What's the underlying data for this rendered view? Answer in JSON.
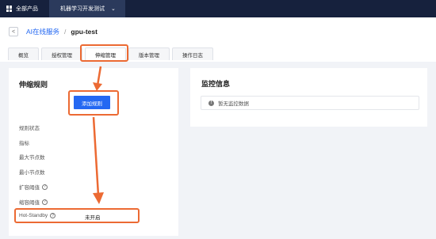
{
  "topbar": {
    "products_label": "全部产品",
    "project_label": "机器学习开发测试",
    "project_chevron": "chevron-down"
  },
  "breadcrumb": {
    "parent": "AI在线服务",
    "separator": "/",
    "current": "gpu-test"
  },
  "tabs": [
    "概览",
    "授权管理",
    "伸缩管理",
    "版本管理",
    "操作日志"
  ],
  "active_tab": "伸缩管理",
  "scaling": {
    "title": "伸缩规则",
    "add_button": "添加规则",
    "rows": [
      {
        "label": "规则状态",
        "help": false,
        "value": ""
      },
      {
        "label": "指标",
        "help": false,
        "value": ""
      },
      {
        "label": "最大节点数",
        "help": false,
        "value": ""
      },
      {
        "label": "最小节点数",
        "help": false,
        "value": ""
      },
      {
        "label": "扩容阈值",
        "help": true,
        "value": ""
      },
      {
        "label": "缩容阈值",
        "help": true,
        "value": ""
      },
      {
        "label": "Hot-Standby",
        "help": true,
        "value": "未开启"
      }
    ],
    "help_mark": "?"
  },
  "monitor": {
    "title": "监控信息",
    "info_mark": "!",
    "empty_text": "暂无监控数据"
  },
  "colors": {
    "topbar": "#16213d",
    "primary": "#2468f2",
    "highlight": "#ec6a33",
    "background": "#f1f3f7"
  }
}
